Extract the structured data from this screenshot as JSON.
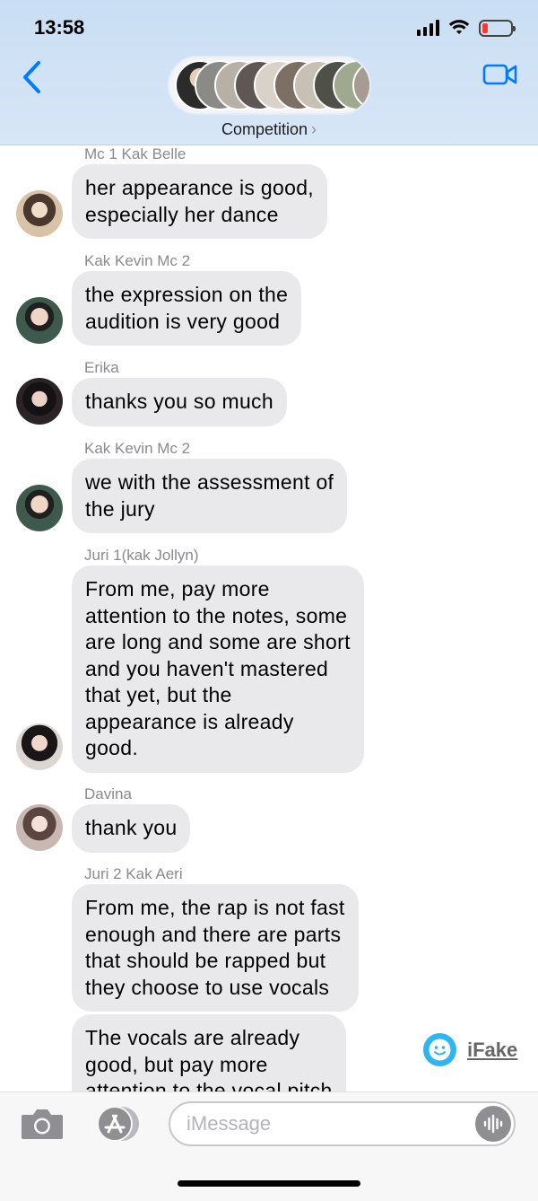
{
  "status_bar": {
    "time": "13:58"
  },
  "header": {
    "group_name": "Competition",
    "group_chevron": "›"
  },
  "messages": [
    {
      "sender": "Mc 1 Kak Belle",
      "text": "her appearance is good,\nespecially her dance",
      "avatar_color": "#d8c3a8"
    },
    {
      "sender": "Kak Kevin Mc 2",
      "text": "the expression on the\naudition is very good",
      "avatar_color": "#3d5a4c"
    },
    {
      "sender": "Erika",
      "text": "thanks you so much",
      "avatar_color": "#2a2426"
    },
    {
      "sender": "Kak Kevin Mc 2",
      "text": "we with the assessment of\nthe jury",
      "avatar_color": "#3d5a4c"
    },
    {
      "sender": "Juri 1(kak Jollyn)",
      "text": "From me, pay more\nattention to the notes, some\nare long and some are short\nand you haven't mastered\nthat yet, but the\nappearance is already\ngood.",
      "avatar_color": "#3a3034"
    },
    {
      "sender": "Davina",
      "text": "thank you",
      "avatar_color": "#c9b8b2"
    },
    {
      "sender": "Juri 2 Kak Aeri",
      "text": "From me, the rap is not fast\nenough and there are parts\nthat should be rapped but\nthey choose to use vocals"
    },
    {
      "text": "The vocals are already\ngood, but pay more\nattention to the vocal pitch"
    }
  ],
  "watermark": {
    "text": "iFake"
  },
  "input": {
    "placeholder": "iMessage"
  },
  "colors": {
    "accent": "#007aff",
    "bubble": "#e9e9eb",
    "header_bg": "#d0e2f5"
  }
}
